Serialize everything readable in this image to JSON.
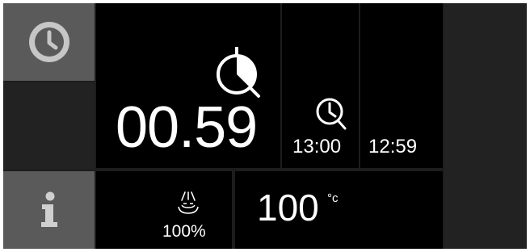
{
  "sidebar": {
    "clock_icon": "clock-icon",
    "info_icon": "info-icon"
  },
  "timer": {
    "remaining": "00.59",
    "icon": "stopwatch-icon"
  },
  "schedule": {
    "start_time": "13:00",
    "start_icon": "small-clock-icon",
    "end_time": "12:59"
  },
  "status": {
    "humidity": "100%",
    "humidity_icon": "steam-icon",
    "temperature": "100",
    "temperature_unit": "°c"
  },
  "colors": {
    "panel": "#000000",
    "sidebar_active": "#5a5a5a",
    "sidebar_idle": "#222222",
    "text": "#ffffff"
  }
}
